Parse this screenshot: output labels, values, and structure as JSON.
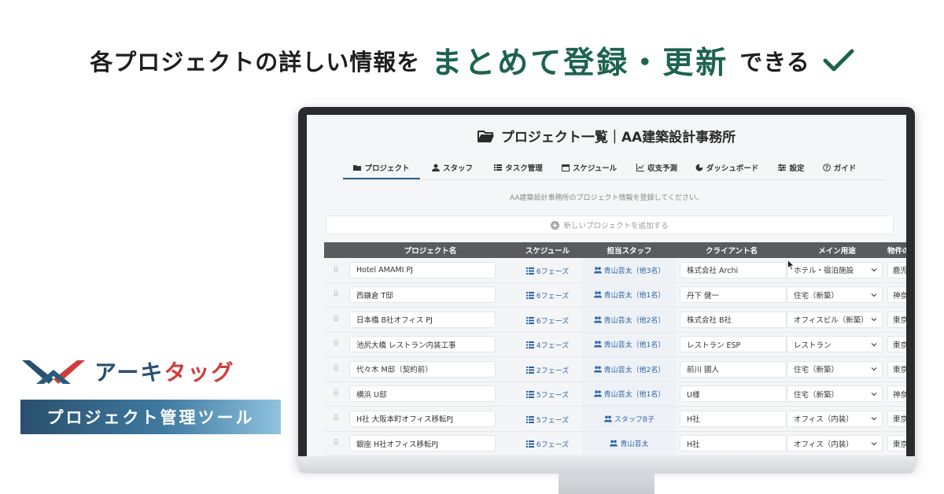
{
  "headline": {
    "part1": "各プロジェクトの詳しい情報を",
    "emphasis": "まとめて登録・更新",
    "part2": "できる"
  },
  "brand": {
    "name_part1": "アーキ",
    "name_part2": "タッグ",
    "badge": "プロジェクト管理ツール",
    "colors": {
      "navy": "#27506f",
      "red": "#cf3d3a"
    }
  },
  "app": {
    "title": "プロジェクト一覧｜AA建築設計事務所",
    "tabs": [
      {
        "label": "プロジェクト",
        "icon": "folder-icon",
        "active": true
      },
      {
        "label": "スタッフ",
        "icon": "user-icon"
      },
      {
        "label": "タスク管理",
        "icon": "list-icon"
      },
      {
        "label": "スケジュール",
        "icon": "calendar-icon"
      },
      {
        "label": "収支予測",
        "icon": "chart-icon"
      },
      {
        "label": "ダッシュボード",
        "icon": "pie-icon"
      },
      {
        "label": "設定",
        "icon": "settings-icon"
      },
      {
        "label": "ガイド",
        "icon": "help-icon"
      }
    ],
    "subtext": "AA建築設計事務所のプロジェクト情報を登録してください。",
    "add_button": "新しいプロジェクトを追加する",
    "table": {
      "headers": [
        "プロジェクト名",
        "スケジュール",
        "担当スタッフ",
        "クライアント名",
        "メイン用途",
        "物件の"
      ],
      "rows": [
        {
          "name": "Hotel AMAMI PJ",
          "schedule": "6フェーズ",
          "staff": "青山芸太（他3名）",
          "client": "株式会社 Archi",
          "use": "ホテル・宿泊施設",
          "loc": "鹿児"
        },
        {
          "name": "西鎌倉 T邸",
          "schedule": "6フェーズ",
          "staff": "青山芸太（他1名）",
          "client": "丹下 健一",
          "use": "住宅（新築）",
          "loc": "神奈"
        },
        {
          "name": "日本橋 B社オフィス PJ",
          "schedule": "6フェーズ",
          "staff": "青山芸太（他2名）",
          "client": "株式会社 B社",
          "use": "オフィスビル（新築）",
          "loc": "東京"
        },
        {
          "name": "池尻大橋 レストラン内装工事",
          "schedule": "4フェーズ",
          "staff": "青山芸太（他1名）",
          "client": "レストラン ESP",
          "use": "レストラン",
          "loc": "東京"
        },
        {
          "name": "代々木 M邸（契約前）",
          "schedule": "2フェーズ",
          "staff": "青山芸太（他2名）",
          "client": "前川 國人",
          "use": "住宅（新築）",
          "loc": "東京"
        },
        {
          "name": "横浜 U邸",
          "schedule": "5フェーズ",
          "staff": "青山芸太（他1名）",
          "client": "U様",
          "use": "住宅（新築）",
          "loc": "神奈"
        },
        {
          "name": "H社 大阪本町オフィス移転PJ",
          "schedule": "5フェーズ",
          "staff": "スタッフB子",
          "client": "H社",
          "use": "オフィス（内装）",
          "loc": "東京"
        },
        {
          "name": "銀座 H社オフィス移転PJ",
          "schedule": "6フェーズ",
          "staff": "青山芸太",
          "client": "H社",
          "use": "オフィス（内装）",
          "loc": "東京"
        }
      ]
    }
  }
}
